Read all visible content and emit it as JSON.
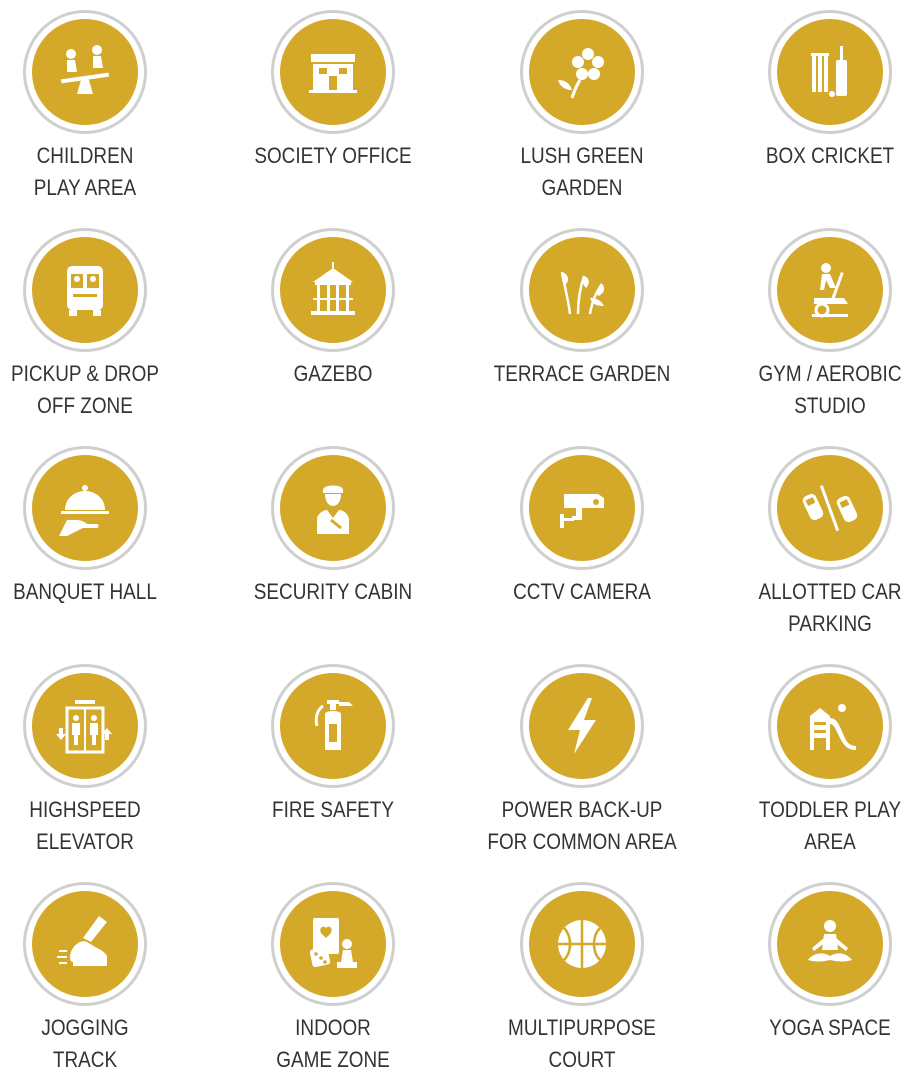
{
  "colors": {
    "badge_fill": "#d4a829",
    "badge_ring": "#cfcfcf",
    "icon": "#ffffff",
    "label_text": "#333333"
  },
  "amenities": [
    {
      "icon": "seesaw-icon",
      "lines": [
        "CHILDREN",
        "PLAY AREA"
      ]
    },
    {
      "icon": "office-building-icon",
      "lines": [
        "SOCIETY OFFICE"
      ]
    },
    {
      "icon": "flower-icon",
      "lines": [
        "LUSH GREEN",
        "GARDEN"
      ]
    },
    {
      "icon": "cricket-bat-wicket-icon",
      "lines": [
        "BOX CRICKET"
      ]
    },
    {
      "icon": "bus-icon",
      "lines": [
        "PICKUP & DROP",
        "OFF ZONE"
      ]
    },
    {
      "icon": "gazebo-icon",
      "lines": [
        "GAZEBO"
      ]
    },
    {
      "icon": "plants-icon",
      "lines": [
        "TERRACE GARDEN"
      ]
    },
    {
      "icon": "exercise-bike-icon",
      "lines": [
        "GYM / AEROBIC",
        "STUDIO"
      ]
    },
    {
      "icon": "cloche-serving-icon",
      "lines": [
        "BANQUET HALL"
      ]
    },
    {
      "icon": "security-guard-icon",
      "lines": [
        "SECURITY CABIN"
      ]
    },
    {
      "icon": "cctv-camera-icon",
      "lines": [
        "CCTV CAMERA"
      ]
    },
    {
      "icon": "parked-cars-icon",
      "lines": [
        "ALLOTTED CAR",
        "PARKING"
      ]
    },
    {
      "icon": "elevator-icon",
      "lines": [
        "HIGHSPEED",
        "ELEVATOR"
      ]
    },
    {
      "icon": "fire-extinguisher-icon",
      "lines": [
        "FIRE SAFETY"
      ]
    },
    {
      "icon": "lightning-bolt-icon",
      "lines": [
        "POWER BACK-UP",
        "FOR COMMON AREA"
      ]
    },
    {
      "icon": "slide-icon",
      "lines": [
        "TODDLER PLAY",
        "AREA"
      ]
    },
    {
      "icon": "running-shoe-icon",
      "lines": [
        "JOGGING",
        "TRACK"
      ]
    },
    {
      "icon": "cards-dice-pawn-icon",
      "lines": [
        "INDOOR",
        "GAME ZONE"
      ]
    },
    {
      "icon": "basketball-icon",
      "lines": [
        "MULTIPURPOSE",
        "COURT"
      ]
    },
    {
      "icon": "yoga-pose-icon",
      "lines": [
        "YOGA SPACE"
      ]
    }
  ]
}
